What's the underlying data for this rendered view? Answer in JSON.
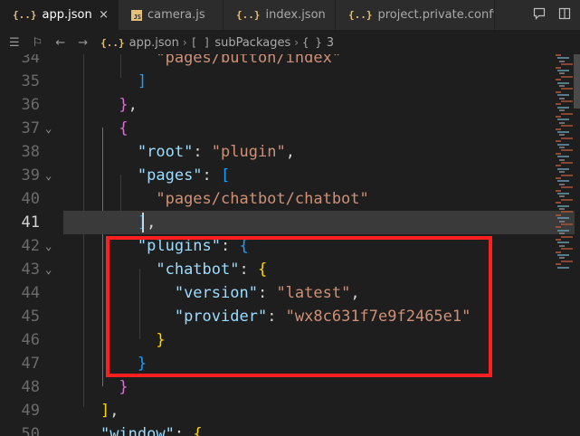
{
  "tabs": [
    {
      "icon": "{..}",
      "label": "app.json",
      "active": true,
      "closable": true
    },
    {
      "icon": "JS",
      "label": "camera.js",
      "active": false
    },
    {
      "icon": "{..}",
      "label": "index.json",
      "active": false
    },
    {
      "icon": "{..}",
      "label": "project.private.config.j",
      "active": false
    }
  ],
  "breadcrumb": {
    "file_icon": "{..}",
    "file": "app.json",
    "array_icon": "[ ]",
    "array": "subPackages",
    "object_icon": "{ }",
    "object": "3"
  },
  "icons": {
    "tab_close": "×",
    "nav_menu": "☰",
    "bookmark": "⚐",
    "back": "←",
    "forward": "→",
    "separator": "›",
    "fold": "⌄"
  },
  "lines": [
    {
      "num": "34",
      "tokens": [
        {
          "t": "          "
        },
        {
          "t": "\"pages/button/index\"",
          "c": "str"
        }
      ]
    },
    {
      "num": "35",
      "tokens": [
        {
          "t": "        "
        },
        {
          "t": "]",
          "c": "br3"
        }
      ]
    },
    {
      "num": "36",
      "tokens": [
        {
          "t": "      "
        },
        {
          "t": "}",
          "c": "br2"
        },
        {
          "t": ","
        }
      ]
    },
    {
      "num": "37",
      "fold": true,
      "tokens": [
        {
          "t": "      "
        },
        {
          "t": "{",
          "c": "br2"
        }
      ]
    },
    {
      "num": "38",
      "tokens": [
        {
          "t": "        "
        },
        {
          "t": "\"root\"",
          "c": "key"
        },
        {
          "t": ": "
        },
        {
          "t": "\"plugin\"",
          "c": "str"
        },
        {
          "t": ","
        }
      ]
    },
    {
      "num": "39",
      "fold": true,
      "tokens": [
        {
          "t": "        "
        },
        {
          "t": "\"pages\"",
          "c": "key"
        },
        {
          "t": ": "
        },
        {
          "t": "[",
          "c": "br3"
        }
      ]
    },
    {
      "num": "40",
      "tokens": [
        {
          "t": "          "
        },
        {
          "t": "\"pages/chatbot/chatbot\"",
          "c": "str"
        }
      ]
    },
    {
      "num": "41",
      "current": true,
      "tokens": [
        {
          "t": "        "
        },
        {
          "t": "]",
          "c": "br3"
        },
        {
          "t": ","
        }
      ]
    },
    {
      "num": "42",
      "fold": true,
      "tokens": [
        {
          "t": "        "
        },
        {
          "t": "\"plugins\"",
          "c": "key"
        },
        {
          "t": ": "
        },
        {
          "t": "{",
          "c": "br3"
        }
      ]
    },
    {
      "num": "43",
      "fold": true,
      "tokens": [
        {
          "t": "          "
        },
        {
          "t": "\"chatbot\"",
          "c": "key"
        },
        {
          "t": ": "
        },
        {
          "t": "{",
          "c": "br"
        }
      ]
    },
    {
      "num": "44",
      "tokens": [
        {
          "t": "            "
        },
        {
          "t": "\"version\"",
          "c": "key"
        },
        {
          "t": ": "
        },
        {
          "t": "\"latest\"",
          "c": "str"
        },
        {
          "t": ","
        }
      ]
    },
    {
      "num": "45",
      "tokens": [
        {
          "t": "            "
        },
        {
          "t": "\"provider\"",
          "c": "key"
        },
        {
          "t": ": "
        },
        {
          "t": "\"wx8c631f7e9f2465e1\"",
          "c": "str"
        }
      ]
    },
    {
      "num": "46",
      "tokens": [
        {
          "t": "          "
        },
        {
          "t": "}",
          "c": "br"
        }
      ]
    },
    {
      "num": "47",
      "tokens": [
        {
          "t": "        "
        },
        {
          "t": "}",
          "c": "br3"
        }
      ]
    },
    {
      "num": "48",
      "tokens": [
        {
          "t": "      "
        },
        {
          "t": "}",
          "c": "br2"
        }
      ]
    },
    {
      "num": "49",
      "tokens": [
        {
          "t": "    "
        },
        {
          "t": "]",
          "c": "br"
        },
        {
          "t": ","
        }
      ]
    },
    {
      "num": "50",
      "tokens": [
        {
          "t": "    "
        },
        {
          "t": "\"window\"",
          "c": "key"
        },
        {
          "t": ": "
        },
        {
          "t": "{",
          "c": "br"
        }
      ]
    }
  ],
  "colors": {
    "editor_bg": "#1e1e1e",
    "key": "#9cdcfe",
    "string": "#ce9178",
    "highlight_box": "#ff1f1f",
    "current_line": "#3a3a3a"
  }
}
